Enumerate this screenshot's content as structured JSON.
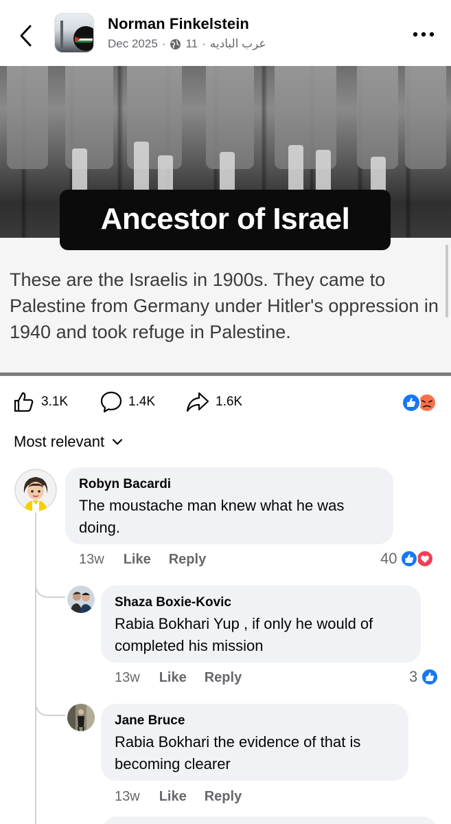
{
  "header": {
    "author": "Norman Finkelstein",
    "date": "Dec 2025",
    "separator": "·",
    "audience_count": "11",
    "group_name": "عرب الباديه",
    "back_icon": "chevron-left-icon",
    "more_icon": "more-horizontal-icon"
  },
  "post_image": {
    "caption": "Ancestor of Israel",
    "description": "These are the Israelis in 1900s. They came to Palestine from Germany under Hitler's oppression in 1940 and took refuge in Palestine."
  },
  "actions": {
    "like_count": "3.1K",
    "comment_count": "1.4K",
    "share_count": "1.6K",
    "reaction_icons": [
      "like-reaction-icon",
      "angry-reaction-icon"
    ]
  },
  "sort": {
    "label": "Most relevant"
  },
  "comments": [
    {
      "name": "Robyn Bacardi",
      "text": "The moustache man knew what he was doing.",
      "time": "13w",
      "like_label": "Like",
      "reply_label": "Reply",
      "reaction_count": "40"
    },
    {
      "name": "Shaza Boxie-Kovic",
      "text": "Rabia Bokhari Yup , if only he would of completed his mission",
      "time": "13w",
      "like_label": "Like",
      "reply_label": "Reply",
      "reaction_count": "3"
    },
    {
      "name": "Jane Bruce",
      "text": "Rabia Bokhari the evidence of that is becoming clearer",
      "time": "13w",
      "like_label": "Like",
      "reply_label": "Reply"
    }
  ],
  "colors": {
    "like_blue": "#1877f2",
    "angry_orange": "#f7714c",
    "love_red": "#f33e58",
    "bubble_bg": "#f0f2f5",
    "muted_text": "#65676b"
  }
}
